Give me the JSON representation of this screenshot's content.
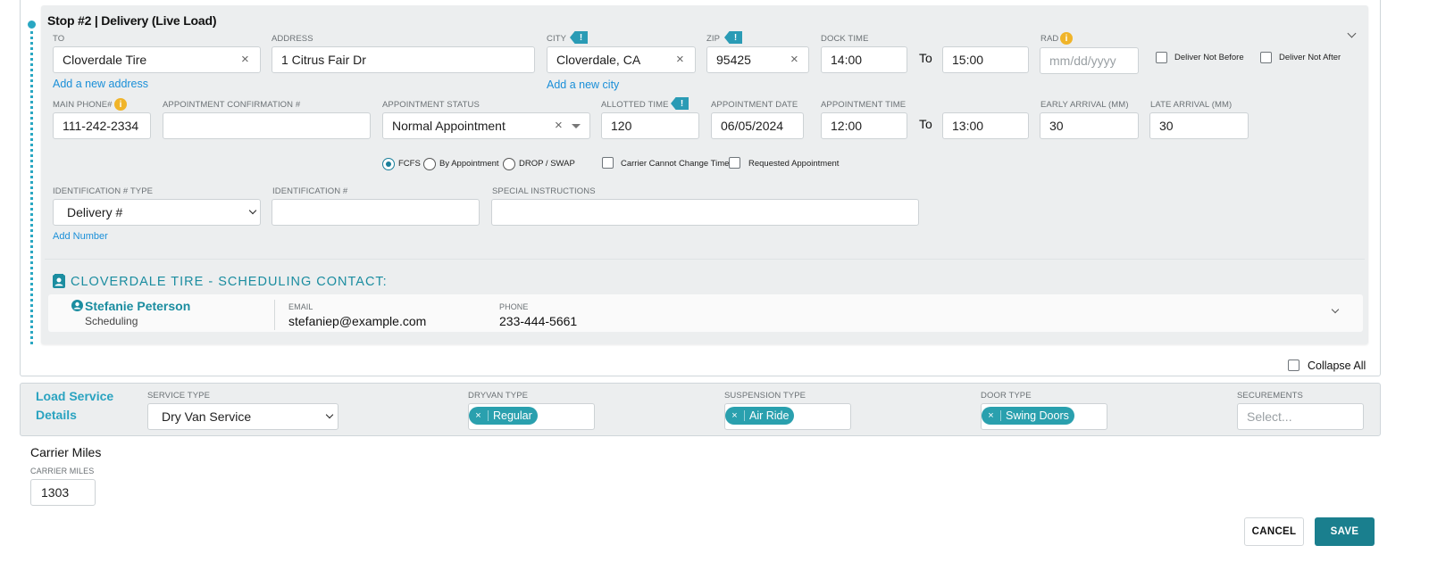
{
  "stop": {
    "title": "Stop #2 | Delivery (Live Load)",
    "to": {
      "label": "TO",
      "value": "Cloverdale Tire",
      "add_link": "Add a new address"
    },
    "address": {
      "label": "ADDRESS",
      "value": "1 Citrus Fair Dr"
    },
    "city": {
      "label": "CITY",
      "value": "Cloverdale, CA",
      "add_link": "Add a new city"
    },
    "zip": {
      "label": "ZIP",
      "value": "95425"
    },
    "dock_time": {
      "label": "DOCK TIME",
      "from": "14:00",
      "to_word": "To",
      "to": "15:00"
    },
    "rad": {
      "label": "RAD",
      "placeholder": "mm/dd/yyyy"
    },
    "deliver_not_before": "Deliver Not Before",
    "deliver_not_after": "Deliver Not After",
    "main_phone": {
      "label": "MAIN PHONE#",
      "value": "111-242-2334"
    },
    "appointment_confirmation": {
      "label": "APPOINTMENT CONFIRMATION #",
      "value": ""
    },
    "appointment_status": {
      "label": "APPOINTMENT STATUS",
      "value": "Normal Appointment"
    },
    "allotted_time": {
      "label": "ALLOTTED TIME",
      "value": "120"
    },
    "appointment_date": {
      "label": "APPOINTMENT DATE",
      "value": "06/05/2024"
    },
    "appointment_time": {
      "label": "APPOINTMENT TIME",
      "from": "12:00",
      "to_word": "To",
      "to": "13:00"
    },
    "early_arrival": {
      "label": "EARLY ARRIVAL (MM)",
      "value": "30"
    },
    "late_arrival": {
      "label": "LATE ARRIVAL (MM)",
      "value": "30"
    },
    "appointment_types": [
      {
        "label": "FCFS",
        "selected": true
      },
      {
        "label": "By Appointment",
        "selected": false
      },
      {
        "label": "DROP / SWAP",
        "selected": false
      }
    ],
    "carrier_cannot_change_time": "Carrier Cannot Change Time",
    "requested_appointment": "Requested Appointment",
    "identification_type": {
      "label": "IDENTIFICATION # TYPE",
      "value": "Delivery #"
    },
    "identification_number": {
      "label": "IDENTIFICATION #",
      "value": ""
    },
    "special_instructions": {
      "label": "SPECIAL INSTRUCTIONS",
      "value": ""
    },
    "add_number_link": "Add Number",
    "info_icon_glyph": "i",
    "flag_icon_glyph": "!",
    "clear_glyph": "×"
  },
  "contact": {
    "heading": "CLOVERDALE TIRE - SCHEDULING CONTACT:",
    "name": "Stefanie Peterson",
    "role": "Scheduling",
    "email_label": "EMAIL",
    "email": "stefaniep@example.com",
    "phone_label": "PHONE",
    "phone": "233-444-5661"
  },
  "collapse_all": "Collapse All",
  "load_service": {
    "title_line1": "Load Service",
    "title_line2": "Details",
    "service_type": {
      "label": "SERVICE TYPE",
      "value": "Dry Van Service"
    },
    "dryvan_type": {
      "label": "DRYVAN TYPE",
      "tag": "Regular"
    },
    "suspension_type": {
      "label": "SUSPENSION TYPE",
      "tag": "Air Ride"
    },
    "door_type": {
      "label": "DOOR TYPE",
      "tag": "Swing Doors"
    },
    "securements": {
      "label": "SECUREMENTS",
      "placeholder": "Select..."
    },
    "tag_remove_glyph": "×"
  },
  "carrier_miles": {
    "heading": "Carrier Miles",
    "label": "CARRIER MILES",
    "value": "1303"
  },
  "actions": {
    "cancel": "CANCEL",
    "save": "SAVE"
  },
  "colors": {
    "accent": "#2aa7c2",
    "save_button": "#1a7f8e",
    "link": "#1a8fd8",
    "info": "#f0b429"
  }
}
